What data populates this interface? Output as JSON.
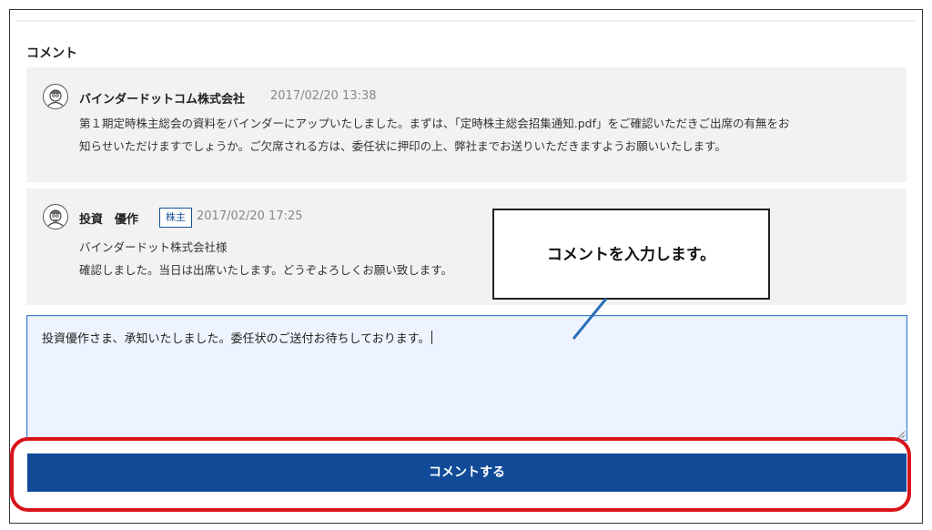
{
  "section": {
    "title": "コメント"
  },
  "comments": [
    {
      "author": "バインダードットコム株式会社",
      "date": "2017/02/20 13:38",
      "lines": [
        "第１期定時株主総会の資料をバインダーにアップいたしました。まずは、「定時株主総会招集通知.pdf」をご確認いただきご出席の有無をお",
        "知らせいただけますでしょうか。ご欠席される方は、委任状に押印の上、弊社までお送りいただきますようお願いいたします。"
      ],
      "avatar_icon": "user-face-icon"
    },
    {
      "author": "投資　優作",
      "badge": "株主",
      "date": "2017/02/20 17:25",
      "lines": [
        "バインダードット株式会社様",
        "確認しました。当日は出席いたします。どうぞよろしくお願い致します。"
      ],
      "avatar_icon": "user-face-icon"
    }
  ],
  "input": {
    "value": "投資優作さま、承知いたしました。委任状のご送付お待ちしております。"
  },
  "submit": {
    "label": "コメントする"
  },
  "callout": {
    "text": "コメントを入力します。"
  },
  "colors": {
    "primary": "#114b98",
    "highlight": "#d9141b",
    "input_bg": "#eef4ff"
  }
}
